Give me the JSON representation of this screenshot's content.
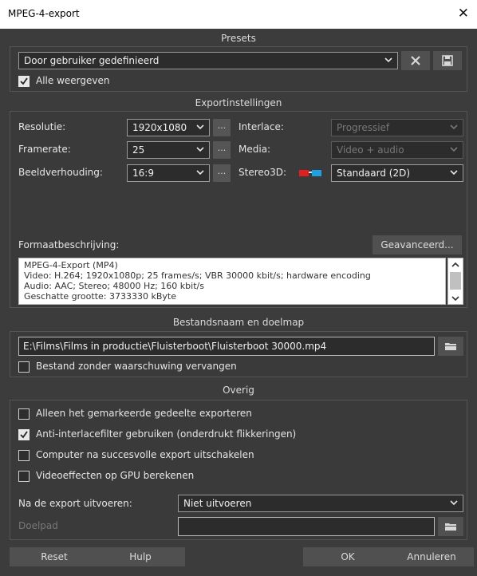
{
  "window": {
    "title": "MPEG-4-export",
    "close": "✕"
  },
  "presets": {
    "header": "Presets",
    "selected": "Door gebruiker gedefinieerd",
    "show_all_label": "Alle weergeven",
    "show_all_checked": true
  },
  "export": {
    "header": "Exportinstellingen",
    "resolution_label": "Resolutie:",
    "resolution_value": "1920x1080",
    "framerate_label": "Framerate:",
    "framerate_value": "25",
    "aspect_label": "Beeldverhouding:",
    "aspect_value": "16:9",
    "dots": "...",
    "interlace_label": "Interlace:",
    "interlace_value": "Progressief",
    "media_label": "Media:",
    "media_value": "Video + audio",
    "stereo_label": "Stereo3D:",
    "stereo_value": "Standaard (2D)",
    "format_label": "Formaatbeschrijving:",
    "advanced_button": "Geavanceerd...",
    "description_lines": [
      "MPEG-4-Export (MP4)",
      "Video: H.264; 1920x1080p; 25 frames/s; VBR 30000 kbit/s; hardware encoding",
      "Audio: AAC; Stereo; 48000 Hz; 160 kbit/s",
      "Geschatte grootte: 3733330 kByte"
    ]
  },
  "file": {
    "header": "Bestandsnaam en doelmap",
    "path": "E:\\Films\\Films in productie\\Fluisterboot\\Fluisterboot 30000.mp4",
    "overwrite_label": "Bestand zonder waarschuwing vervangen",
    "overwrite_checked": false
  },
  "other": {
    "header": "Overig",
    "options": [
      {
        "label": "Alleen het gemarkeerde gedeelte exporteren",
        "checked": false
      },
      {
        "label": "Anti-interlacefilter gebruiken (onderdrukt flikkeringen)",
        "checked": true
      },
      {
        "label": "Computer na succesvolle export uitschakelen",
        "checked": false
      },
      {
        "label": "Videoeffecten op GPU berekenen",
        "checked": false
      }
    ],
    "after_export_label": "Na de export uitvoeren:",
    "after_export_value": "Niet uitvoeren",
    "target_path_label": "Doelpad",
    "target_path_value": ""
  },
  "buttons": {
    "reset": "Reset",
    "help": "Hulp",
    "ok": "OK",
    "cancel": "Annuleren"
  },
  "colors": {
    "background": "#3c3c3c",
    "panel_border": "#555555",
    "button": "#505050",
    "checkbox_on": "#e8e8e8"
  }
}
